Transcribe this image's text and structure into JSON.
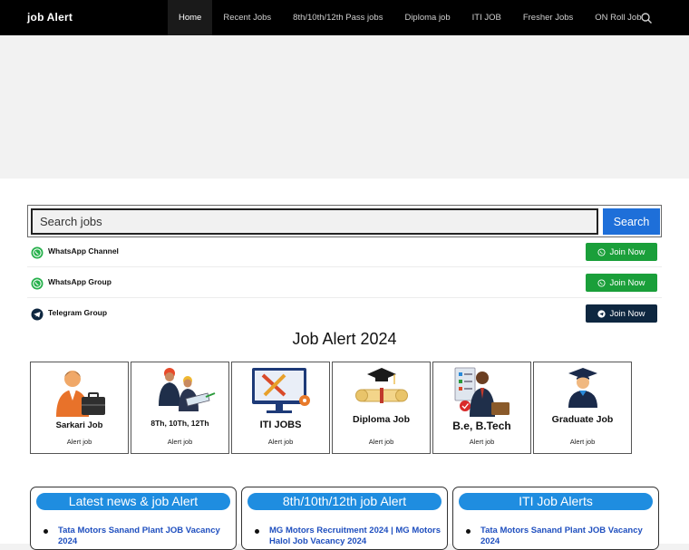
{
  "header": {
    "brand": "job Alert",
    "nav": [
      {
        "label": "Home",
        "active": true
      },
      {
        "label": "Recent Jobs"
      },
      {
        "label": "8th/10th/12th Pass jobs"
      },
      {
        "label": "Diploma job"
      },
      {
        "label": "ITI JOB"
      },
      {
        "label": "Fresher Jobs"
      },
      {
        "label": "ON Roll Job"
      }
    ],
    "search_icon": "search-icon"
  },
  "search": {
    "placeholder": "Search jobs",
    "button_label": "Search"
  },
  "join_rows": [
    {
      "label": "WhatsApp Channel",
      "icon": "whatsapp-icon",
      "button": "Join Now",
      "color": "#1a9f3a"
    },
    {
      "label": "WhatsApp Group",
      "icon": "whatsapp-icon",
      "button": "Join Now",
      "color": "#1a9f3a"
    },
    {
      "label": "Telegram Group",
      "icon": "telegram-icon",
      "button": "Join Now",
      "color": "#0e2740"
    }
  ],
  "section_title": "Job Alert 2024",
  "categories": [
    {
      "name": "Sarkari Job",
      "sub": "Alert job",
      "icon": "officer-briefcase-icon"
    },
    {
      "name": "8Th, 10Th, 12Th",
      "sub": "Alert job",
      "icon": "engineers-icon"
    },
    {
      "name": "ITI JOBS",
      "sub": "Alert job",
      "icon": "tools-monitor-icon"
    },
    {
      "name": "Diploma Job",
      "sub": "Alert job",
      "icon": "diploma-scroll-icon"
    },
    {
      "name": "B.e, B.Tech",
      "sub": "Alert job",
      "icon": "engineer-checklist-icon"
    },
    {
      "name": "Graduate Job",
      "sub": "Alert job",
      "icon": "graduate-icon"
    }
  ],
  "panels": [
    {
      "title": "Latest news & job Alert",
      "item": "Tata Motors Sanand Plant JOB Vacancy 2024"
    },
    {
      "title": "8th/10th/12th job Alert",
      "item": "MG Motors Recruitment 2024 | MG Motors Halol Job Vacancy 2024"
    },
    {
      "title": "ITI Job Alerts",
      "item": "Tata Motors Sanand Plant JOB Vacancy 2024"
    }
  ],
  "colors": {
    "accent": "#1e6fd9",
    "panel_head": "#1f8de0",
    "whatsapp": "#1a9f3a",
    "telegram": "#0e2740",
    "link": "#1f4fbf"
  }
}
